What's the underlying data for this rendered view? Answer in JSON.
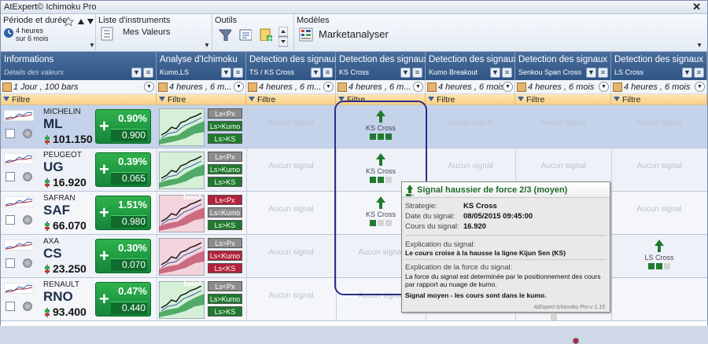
{
  "window": {
    "title": "AtExpert© Ichimoku Pro",
    "close": "✕"
  },
  "ribbon": {
    "periode": {
      "header": "Période et durée",
      "line1": "4 heures",
      "line2": "sur 6 mois"
    },
    "instruments": {
      "header": "Liste d'instruments",
      "value": "Mes Valeurs"
    },
    "outils": {
      "header": "Outils"
    },
    "modeles": {
      "header": "Modèles",
      "value": "Marketanalyser"
    }
  },
  "columns": [
    {
      "title": "Informations",
      "sub": "Détails des valeurs",
      "sel": "1 Jour , 100 bars",
      "filter": "Filtre"
    },
    {
      "title": "Analyse d'Ichimoku",
      "sub": "Kumo,LS",
      "sel": "4 heures , 6 m...",
      "filter": "Filtre"
    },
    {
      "title": "Detection des signaux",
      "sub": "TS / KS Cross",
      "sel": "4 heures , 6 m...",
      "filter": "Filtre"
    },
    {
      "title": "Detection des signaux",
      "sub": "KS Cross",
      "sel": "4 heures , 6 m...",
      "filter": "Filtre"
    },
    {
      "title": "Detection des signaux",
      "sub": "Kumo Breakout",
      "sel": "4 heures , 6 mois",
      "filter": "Filtre"
    },
    {
      "title": "Detection des signaux",
      "sub": "Senkou Span Cross",
      "sel": "4 heures , 6 mois",
      "filter": "Filtre"
    },
    {
      "title": "Detection des signaux",
      "sub": "LS Cross",
      "sel": "4 heures , 6 mois",
      "filter": "Filtre"
    }
  ],
  "rows": [
    {
      "name": "MICHELIN",
      "ticker": "ML",
      "price": "101.150",
      "pct": "0.90%",
      "chg": "0.900",
      "labels": [
        "Ls<Px",
        "Ls>Kumo",
        "Ls>KS"
      ],
      "aucun": "Aucun signal",
      "signal": "KS Cross",
      "twist": ""
    },
    {
      "name": "PEUGEOT",
      "ticker": "UG",
      "price": "16.920",
      "pct": "0.39%",
      "chg": "0.065",
      "labels": [
        "Ls<Px",
        "Ls>Kumo",
        "Ls>KS"
      ],
      "aucun": "Aucun signal",
      "signal": "KS Cross",
      "twist": ""
    },
    {
      "name": "SAFRAN",
      "ticker": "SAF",
      "price": "66.070",
      "pct": "1.51%",
      "chg": "0.980",
      "labels": [
        "Ls<Px",
        "Ls=Kumo",
        "Ls>KS"
      ],
      "aucun": "Aucun signal",
      "signal": "KS Cross",
      "twist": "twist"
    },
    {
      "name": "AXA",
      "ticker": "CS",
      "price": "23.250",
      "pct": "0.30%",
      "chg": "0.070",
      "labels": [
        "Ls>Px",
        "Ls<Kumo",
        "Ls<KS"
      ],
      "aucun": "Aucun signal",
      "signal": "LS Cross",
      "twist": ""
    },
    {
      "name": "RENAULT",
      "ticker": "RNO",
      "price": "93.400",
      "pct": "0.47%",
      "chg": "0.440",
      "labels": [
        "Ls<Px",
        "Ls>Kumo",
        "Ls>KS"
      ],
      "aucun": "Aucun signal",
      "signal": "",
      "twist": "twist"
    }
  ],
  "tooltip": {
    "title": "Signal haussier de force 2/3 (moyen)",
    "k1": "Strategie:",
    "v1": "KS Cross",
    "k2": "Date du signal:",
    "v2": "08/05/2015 09:45:00",
    "k3": "Cours du signal:",
    "v3": "16.920",
    "expl_h": "Explication du signal:",
    "expl": "Le cours croise à la hausse la ligne Kijun Sen (KS)",
    "force_h": "Explication de la force du signal:",
    "force1": "La force du signal est determinée par le positionnement des cours",
    "force2": "par rapport au nuage de kumo.",
    "concl": "Signal moyen - les cours sont dans le kumo.",
    "footer": "AtExpert Ichimoku Pro v 1.15"
  },
  "colors": {
    "up": "#1f7a2e",
    "down": "#b2223a",
    "header": "#2f5585"
  }
}
